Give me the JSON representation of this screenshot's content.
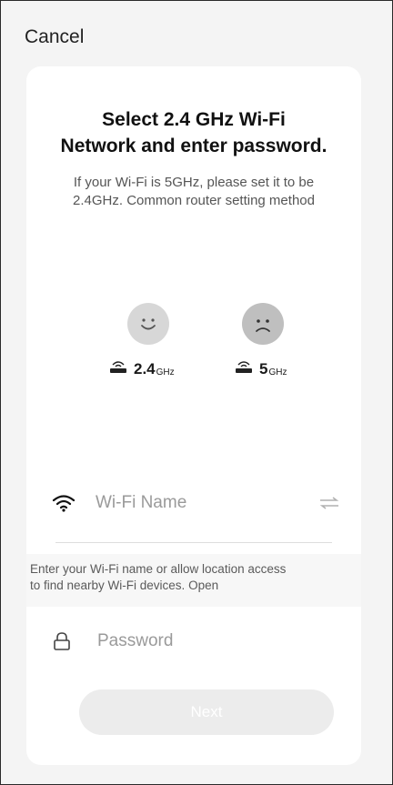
{
  "header": {
    "cancel_label": "Cancel"
  },
  "main": {
    "title_line1": "Select 2.4 GHz Wi-Fi",
    "title_line2": "Network and enter password.",
    "subtitle_line1": "If your Wi-Fi is 5GHz, please set it to be",
    "subtitle_line2": "2.4GHz. Common router setting method"
  },
  "bands": [
    {
      "value": "2.4",
      "unit": "GHz",
      "face_icon": "happy-face-icon"
    },
    {
      "value": "5",
      "unit": "GHz",
      "face_icon": "sad-face-icon"
    }
  ],
  "wifi": {
    "placeholder": "Wi-Fi Name",
    "value": "",
    "icon": "wifi-icon",
    "switch_icon": "switch-network-icon"
  },
  "hint": {
    "text_line1": "Enter your Wi-Fi name or allow location access",
    "text_line2": "to find nearby Wi-Fi devices.",
    "link_label": "Open"
  },
  "password": {
    "placeholder": "Password",
    "value": "",
    "icon": "lock-icon"
  },
  "next_label": "Next",
  "colors": {
    "background": "#f4f4f4",
    "card": "#ffffff",
    "button_disabled": "#ececec",
    "placeholder": "#9a9a9a"
  }
}
